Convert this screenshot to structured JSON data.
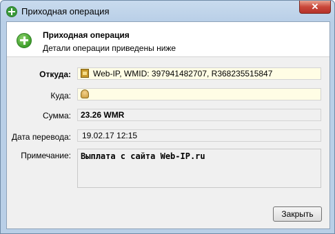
{
  "window": {
    "title": "Приходная операция",
    "close_glyph": "✕"
  },
  "header": {
    "title": "Приходная операция",
    "subtitle": "Детали операции приведены ниже"
  },
  "form": {
    "from_label": "Откуда:",
    "from_value": "Web-IP, WMID: 397941482707, R368235515847",
    "to_label": "Куда:",
    "to_value": "",
    "amount_label": "Сумма:",
    "amount_value": "23.26 WMR",
    "date_label": "Дата перевода:",
    "date_value": "19.02.17 12:15",
    "note_label": "Примечание:",
    "note_value": "Выплата с сайта Web-IP.ru"
  },
  "buttons": {
    "close_label": "Закрыть"
  },
  "icons": {
    "title": "plus-circle-icon",
    "header": "plus-circle-icon",
    "from": "wallet-icon",
    "to": "person-icon"
  },
  "colors": {
    "accent_green": "#3d9d2a",
    "close_red": "#c9473a",
    "field_yellow": "#fffde5"
  }
}
